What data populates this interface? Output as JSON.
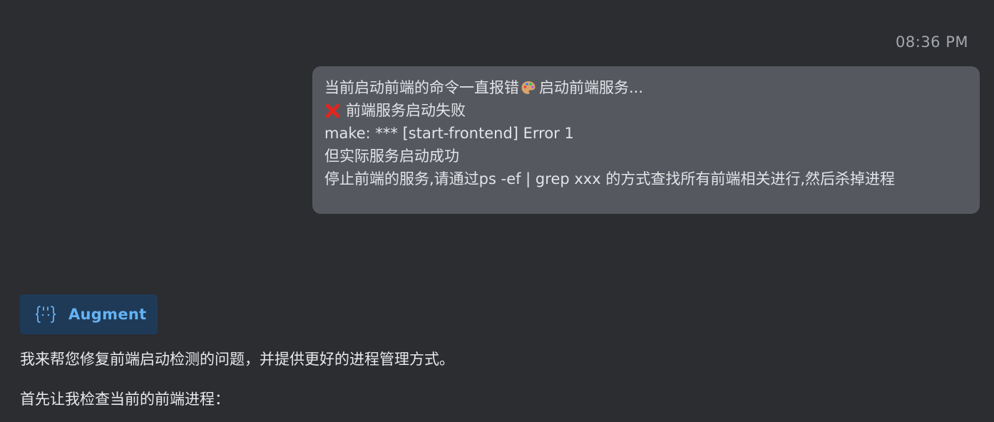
{
  "timestamp": "08:36 PM",
  "user_message": {
    "line1_a": "当前启动前端的命令一直报错",
    "line1_icon": "palette-icon",
    "line1_b": " 启动前端服务...",
    "line2_icon": "cross-mark-icon",
    "line2": "前端服务启动失败",
    "line3": "make: *** [start-frontend] Error 1",
    "line4": "但实际服务启动成功",
    "line5": "停止前端的服务,请通过ps -ef | grep xxx 的方式查找所有前端相关进行,然后杀掉进程"
  },
  "agent": {
    "name": "Augment",
    "icon": "augment-icon",
    "accent_color": "#64b3f5",
    "badge_bg": "#1f3a57"
  },
  "assistant_message": {
    "paragraph1": "我来帮您修复前端启动检测的问题，并提供更好的进程管理方式。",
    "paragraph2": "首先让我检查当前的前端进程："
  },
  "colors": {
    "background": "#2b2d31",
    "user_bubble": "#55585f",
    "error_red": "#e0261f"
  }
}
